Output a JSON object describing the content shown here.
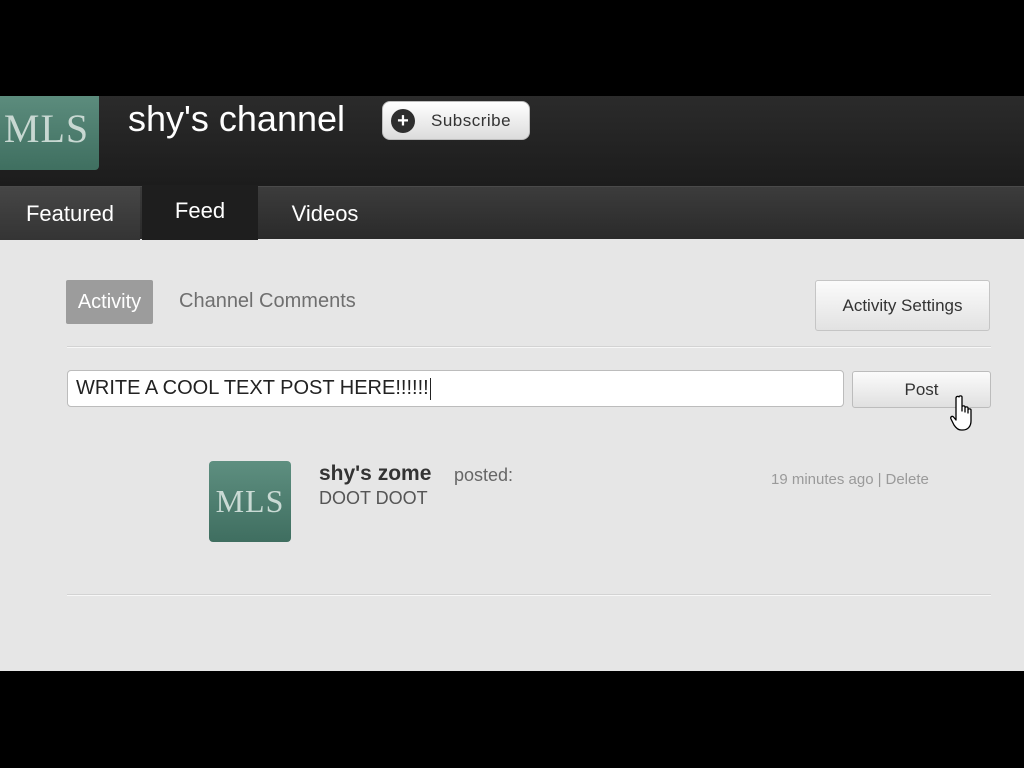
{
  "header": {
    "avatar_text": "MLS",
    "channel_title": "shy's channel",
    "subscribe_label": "Subscribe",
    "avatar_color": "#4f7f70"
  },
  "nav": {
    "tabs": [
      {
        "label": "Featured",
        "active": false
      },
      {
        "label": "Feed",
        "active": true
      },
      {
        "label": "Videos",
        "active": false
      }
    ]
  },
  "feed_panel": {
    "subtabs": [
      {
        "label": "Activity",
        "active": true
      },
      {
        "label": "Channel Comments",
        "active": false
      }
    ],
    "settings_label": "Activity Settings",
    "post_input_value": "WRITE A COOL TEXT POST HERE!!!!!!",
    "post_button_label": "Post"
  },
  "feed_items": [
    {
      "avatar_text": "MLS",
      "author": "shy's zome",
      "verb": "posted:",
      "text": "DOOT DOOT",
      "time": "19 minutes ago",
      "separator": "|",
      "delete_label": "Delete"
    }
  ]
}
